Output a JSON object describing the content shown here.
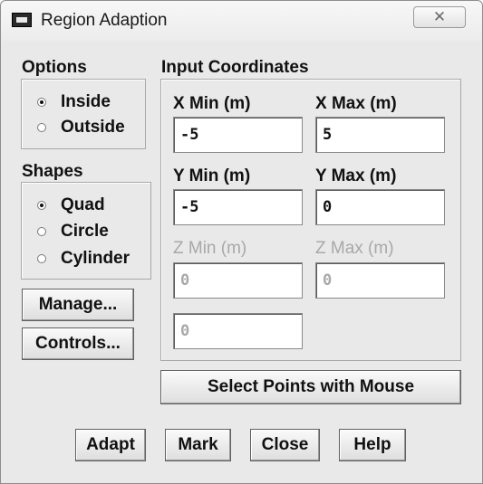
{
  "window": {
    "title": "Region Adaption",
    "close_glyph": "☒"
  },
  "options": {
    "label": "Options",
    "items": [
      "Inside",
      "Outside"
    ],
    "selected": "Inside"
  },
  "shapes": {
    "label": "Shapes",
    "items": [
      "Quad",
      "Circle",
      "Cylinder"
    ],
    "selected": "Quad"
  },
  "side_buttons": {
    "manage": "Manage...",
    "controls": "Controls..."
  },
  "input_coordinates": {
    "label": "Input Coordinates",
    "x_min": {
      "label": "X Min (m)",
      "value": "-5"
    },
    "x_max": {
      "label": "X Max (m)",
      "value": "5"
    },
    "y_min": {
      "label": "Y Min (m)",
      "value": "-5"
    },
    "y_max": {
      "label": "Y Max (m)",
      "value": "0"
    },
    "z_min": {
      "label": "Z Min (m)",
      "value": "0",
      "enabled": false
    },
    "z_max": {
      "label": "Z Max (m)",
      "value": "0",
      "enabled": false
    },
    "radius": {
      "value": "0",
      "enabled": false
    }
  },
  "select_points_button": "Select Points with Mouse",
  "footer": {
    "adapt": "Adapt",
    "mark": "Mark",
    "close": "Close",
    "help": "Help"
  }
}
